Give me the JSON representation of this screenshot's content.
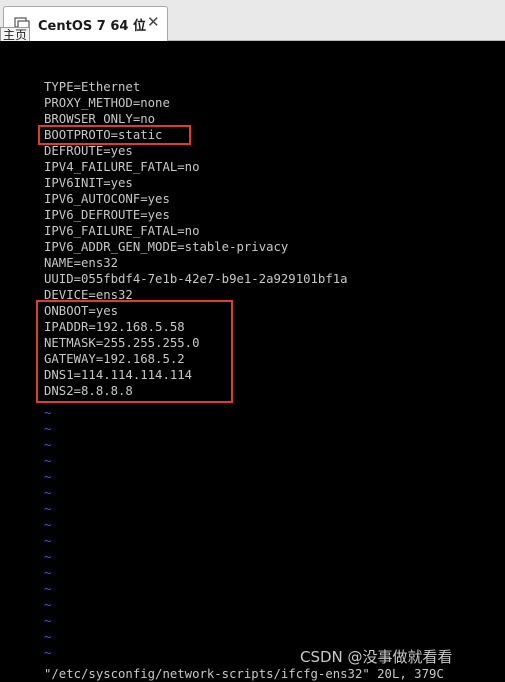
{
  "window": {
    "tab_title": "CentOS 7 64 位",
    "close_glyph": "✕",
    "home_label": "主页",
    "icon": "vm-icon"
  },
  "editor": {
    "lines": [
      "TYPE=Ethernet",
      "PROXY_METHOD=none",
      "BROWSER_ONLY=no",
      "BOOTPROTO=static",
      "DEFROUTE=yes",
      "IPV4_FAILURE_FATAL=no",
      "IPV6INIT=yes",
      "IPV6_AUTOCONF=yes",
      "IPV6_DEFROUTE=yes",
      "IPV6_FAILURE_FATAL=no",
      "IPV6_ADDR_GEN_MODE=stable-privacy",
      "NAME=ens32",
      "UUID=055fbdf4-7e1b-42e7-b9e1-2a929101bf1a",
      "DEVICE=ens32",
      "ONBOOT=yes",
      "IPADDR=192.168.5.58",
      "NETMASK=255.255.255.0",
      "GATEWAY=192.168.5.2",
      "DNS1=114.114.114.114",
      "DNS2=8.8.8.8"
    ],
    "tilde": "~",
    "tilde_count": 16,
    "status_line": "\"/etc/sysconfig/network-scripts/ifcfg-ens32\" 20L, 379C"
  },
  "highlight_color": "#e03b2f",
  "watermark": "CSDN @没事做就看看"
}
